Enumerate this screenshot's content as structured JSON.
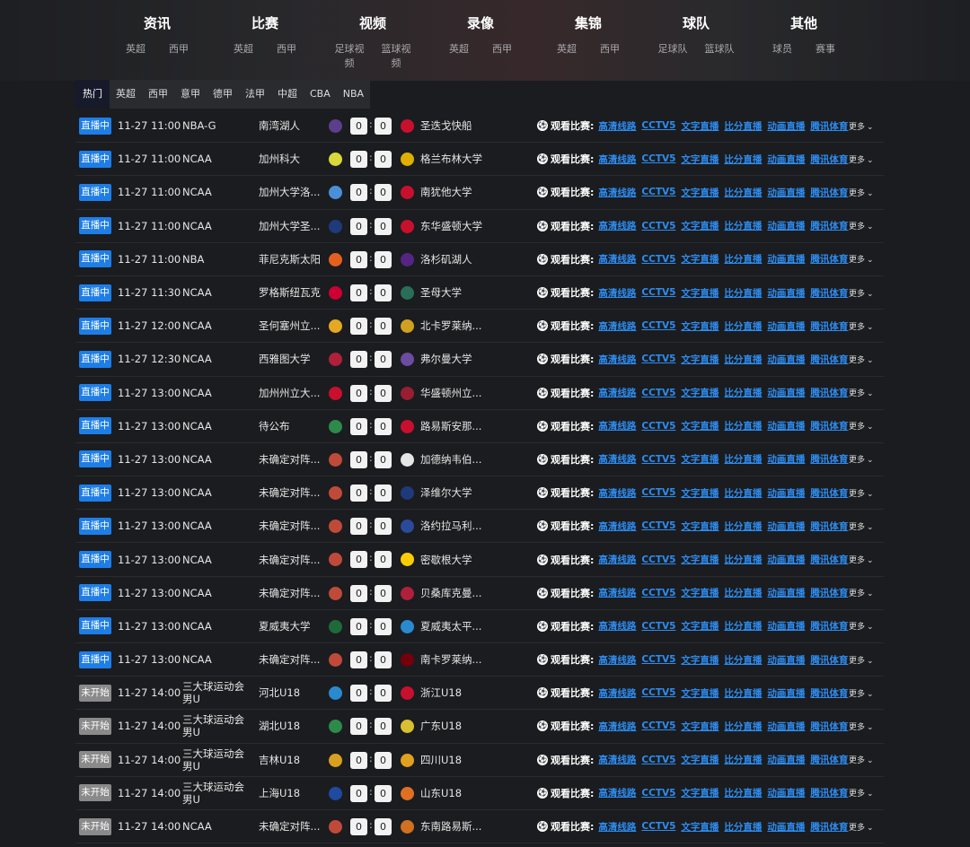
{
  "nav": [
    {
      "title": "资讯",
      "subs": [
        "英超",
        "西甲"
      ]
    },
    {
      "title": "比赛",
      "subs": [
        "英超",
        "西甲"
      ]
    },
    {
      "title": "视频",
      "subs": [
        "足球视频",
        "篮球视频"
      ]
    },
    {
      "title": "录像",
      "subs": [
        "英超",
        "西甲"
      ]
    },
    {
      "title": "集锦",
      "subs": [
        "英超",
        "西甲"
      ]
    },
    {
      "title": "球队",
      "subs": [
        "足球队",
        "篮球队"
      ]
    },
    {
      "title": "其他",
      "subs": [
        "球员",
        "赛事"
      ]
    }
  ],
  "tabs": [
    "热门",
    "英超",
    "西甲",
    "意甲",
    "德甲",
    "法甲",
    "中超",
    "CBA",
    "NBA"
  ],
  "active_tab": 0,
  "watch_label": "观看比赛:",
  "links": [
    "高清线路",
    "CCTV5",
    "文字直播",
    "比分直播",
    "动画直播",
    "腾讯体育"
  ],
  "more_label": "更多",
  "matches": [
    {
      "status": "直播中",
      "time": "11-27 11:00",
      "league": "NBA-G",
      "home": "南湾湖人",
      "hs": "0",
      "as": "0",
      "away": "圣迭戈快船",
      "hc": "#5b3f8c",
      "ac": "#c8102e"
    },
    {
      "status": "直播中",
      "time": "11-27 11:00",
      "league": "NCAA",
      "home": "加州科大",
      "hs": "0",
      "as": "0",
      "away": "格兰布林大学",
      "hc": "#d8d83a",
      "ac": "#e0b000"
    },
    {
      "status": "直播中",
      "time": "11-27 11:00",
      "league": "NCAA",
      "home": "加州大学洛...",
      "hs": "0",
      "as": "0",
      "away": "南犹他大学",
      "hc": "#4a90d9",
      "ac": "#c8102e"
    },
    {
      "status": "直播中",
      "time": "11-27 11:00",
      "league": "NCAA",
      "home": "加州大学圣...",
      "hs": "0",
      "as": "0",
      "away": "东华盛顿大学",
      "hc": "#1f3a7a",
      "ac": "#c8102e"
    },
    {
      "status": "直播中",
      "time": "11-27 11:00",
      "league": "NBA",
      "home": "菲尼克斯太阳",
      "hs": "0",
      "as": "0",
      "away": "洛杉矶湖人",
      "hc": "#e56020",
      "ac": "#552583"
    },
    {
      "status": "直播中",
      "time": "11-27 11:30",
      "league": "NCAA",
      "home": "罗格斯纽瓦克",
      "hs": "0",
      "as": "0",
      "away": "圣母大学",
      "hc": "#cc0033",
      "ac": "#2a6e5a"
    },
    {
      "status": "直播中",
      "time": "11-27 12:00",
      "league": "NCAA",
      "home": "圣何塞州立...",
      "hs": "0",
      "as": "0",
      "away": "北卡罗莱纳...",
      "hc": "#e5a823",
      "ac": "#d0a020"
    },
    {
      "status": "直播中",
      "time": "11-27 12:30",
      "league": "NCAA",
      "home": "西雅图大学",
      "hs": "0",
      "as": "0",
      "away": "弗尔曼大学",
      "hc": "#b0203a",
      "ac": "#6a4ca0"
    },
    {
      "status": "直播中",
      "time": "11-27 13:00",
      "league": "NCAA",
      "home": "加州州立大...",
      "hs": "0",
      "as": "0",
      "away": "华盛顿州立...",
      "hc": "#c8102e",
      "ac": "#981e32"
    },
    {
      "status": "直播中",
      "time": "11-27 13:00",
      "league": "NCAA",
      "home": "待公布",
      "hs": "0",
      "as": "0",
      "away": "路易斯安那...",
      "hc": "#2d8a4a",
      "ac": "#c8102e"
    },
    {
      "status": "直播中",
      "time": "11-27 13:00",
      "league": "NCAA",
      "home": "未确定对阵...",
      "hs": "0",
      "as": "0",
      "away": "加德纳韦伯...",
      "hc": "#c04a3a",
      "ac": "#e6e6e6"
    },
    {
      "status": "直播中",
      "time": "11-27 13:00",
      "league": "NCAA",
      "home": "未确定对阵...",
      "hs": "0",
      "as": "0",
      "away": "泽维尔大学",
      "hc": "#c04a3a",
      "ac": "#1f3a7a"
    },
    {
      "status": "直播中",
      "time": "11-27 13:00",
      "league": "NCAA",
      "home": "未确定对阵...",
      "hs": "0",
      "as": "0",
      "away": "洛约拉马利...",
      "hc": "#c04a3a",
      "ac": "#2a4a9a"
    },
    {
      "status": "直播中",
      "time": "11-27 13:00",
      "league": "NCAA",
      "home": "未确定对阵...",
      "hs": "0",
      "as": "0",
      "away": "密歇根大学",
      "hc": "#c04a3a",
      "ac": "#ffcb05"
    },
    {
      "status": "直播中",
      "time": "11-27 13:00",
      "league": "NCAA",
      "home": "未确定对阵...",
      "hs": "0",
      "as": "0",
      "away": "贝桑库克曼...",
      "hc": "#c04a3a",
      "ac": "#b0203a"
    },
    {
      "status": "直播中",
      "time": "11-27 13:00",
      "league": "NCAA",
      "home": "夏威夷大学",
      "hs": "0",
      "as": "0",
      "away": "夏威夷太平...",
      "hc": "#1e6a3a",
      "ac": "#2a8ad0"
    },
    {
      "status": "直播中",
      "time": "11-27 13:00",
      "league": "NCAA",
      "home": "未确定对阵...",
      "hs": "0",
      "as": "0",
      "away": "南卡罗莱纳...",
      "hc": "#c04a3a",
      "ac": "#73000a"
    },
    {
      "status": "未开始",
      "time": "11-27 14:00",
      "league": "三大球运动会男U",
      "home": "河北U18",
      "hs": "0",
      "as": "0",
      "away": "浙江U18",
      "hc": "#2a8ad0",
      "ac": "#c8102e"
    },
    {
      "status": "未开始",
      "time": "11-27 14:00",
      "league": "三大球运动会男U",
      "home": "湖北U18",
      "hs": "0",
      "as": "0",
      "away": "广东U18",
      "hc": "#2d8a4a",
      "ac": "#d8c030"
    },
    {
      "status": "未开始",
      "time": "11-27 14:00",
      "league": "三大球运动会男U",
      "home": "吉林U18",
      "hs": "0",
      "as": "0",
      "away": "四川U18",
      "hc": "#d8a020",
      "ac": "#e0a020"
    },
    {
      "status": "未开始",
      "time": "11-27 14:00",
      "league": "三大球运动会男U",
      "home": "上海U18",
      "hs": "0",
      "as": "0",
      "away": "山东U18",
      "hc": "#1f4aa0",
      "ac": "#e07020"
    },
    {
      "status": "未开始",
      "time": "11-27 14:00",
      "league": "NCAA",
      "home": "未确定对阵...",
      "hs": "0",
      "as": "0",
      "away": "东南路易斯...",
      "hc": "#c04a3a",
      "ac": "#d07020"
    }
  ]
}
